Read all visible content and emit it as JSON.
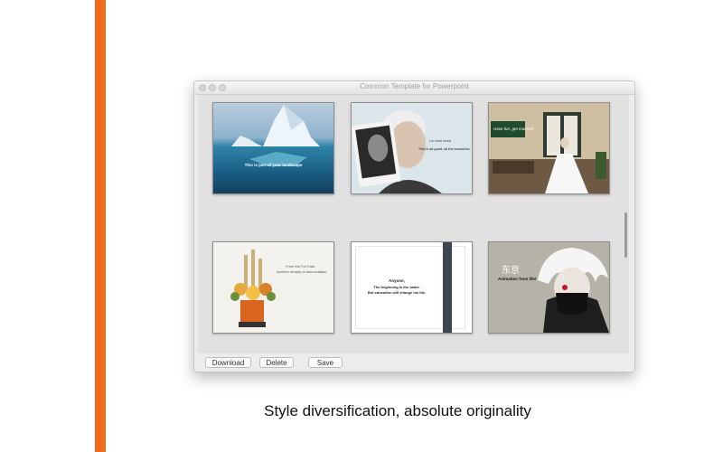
{
  "window": {
    "title": "Common Template for Powerpoint"
  },
  "templates": [
    {
      "text": "This is part of your landscape"
    },
    {
      "line1": "Let time keep",
      "line2": "This is all good, all the memories."
    },
    {
      "text": "Have fun, get married!"
    },
    {
      "line1": "From the Far East,",
      "line2": "Another beauty of annunciation."
    },
    {
      "line1": "Anyone,",
      "line2": "The beginning is the same.",
      "line3": "But education will change his life."
    },
    {
      "line1": "东京",
      "line2": "Animation from life!"
    }
  ],
  "buttons": {
    "download": "Download",
    "delete": "Delete",
    "save": "Save"
  },
  "caption": "Style diversification, absolute originality"
}
